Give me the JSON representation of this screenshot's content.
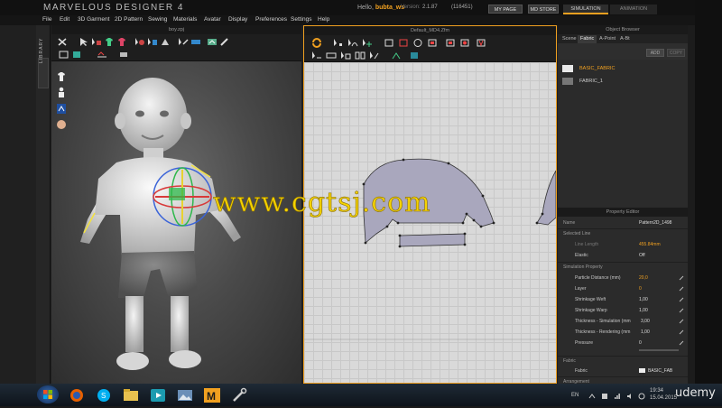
{
  "app": {
    "title": "MARVELOUS DESIGNER 4",
    "greeting_prefix": "Hello,",
    "username": "bubta_ws",
    "version_label": "Version:",
    "version": "2.1.87",
    "build": "(116451)",
    "my_page": "MY PAGE",
    "md_store": "MD STORE",
    "mode_simulation": "SIMULATION",
    "mode_animation": "ANIMATION"
  },
  "menu": [
    "File",
    "Edit",
    "3D Garment",
    "2D Pattern",
    "Sewing",
    "Materials",
    "Avatar",
    "Display",
    "Preferences",
    "Settings",
    "Help"
  ],
  "library_label": "LIBRARY",
  "window3d_title": "boy.zpj",
  "window2d_title": "Default_MD4.Zfm",
  "object_browser": {
    "title": "Object Browser",
    "tabs": [
      "Scene",
      "Fabric",
      "A-Point",
      "A-Bt"
    ],
    "active_tab": "Fabric",
    "add_label": "ADD",
    "copy_label": "COPY",
    "fabrics": [
      {
        "name": "BASIC_FABRIC",
        "swatch": "#e8e8e8",
        "selected": true
      },
      {
        "name": "FABRIC_1",
        "swatch": "#777777",
        "selected": false
      }
    ]
  },
  "property_editor": {
    "title": "Property Editor",
    "rows": [
      {
        "label": "Name",
        "value": "Pattern2D_1498",
        "type": "field"
      },
      {
        "label": "Selected Line",
        "value": "",
        "type": "section"
      },
      {
        "label": "Line Length",
        "value": "455.84mm",
        "type": "field",
        "orange": true
      },
      {
        "label": "Elastic",
        "value": "Off",
        "type": "field"
      },
      {
        "label": "Simulation Property",
        "value": "",
        "type": "section"
      },
      {
        "label": "Particle Distance (mm)",
        "value": "20,0",
        "type": "field",
        "orange": true
      },
      {
        "label": "Layer",
        "value": "0",
        "type": "field",
        "orange": true
      },
      {
        "label": "Shrinkage Weft",
        "value": "1,00",
        "type": "field"
      },
      {
        "label": "Shrinkage Warp",
        "value": "1,00",
        "type": "field"
      },
      {
        "label": "Thickness - Simulation (mm",
        "value": "3,00",
        "type": "field"
      },
      {
        "label": "Thickness - Rendering (mm",
        "value": "1,00",
        "type": "field"
      },
      {
        "label": "Pressure",
        "value": "0",
        "type": "field"
      },
      {
        "label": "Fabric",
        "value": "",
        "type": "section"
      },
      {
        "label": "Fabric",
        "value": "BASIC_FAB",
        "type": "field"
      },
      {
        "label": "Arrangement",
        "value": "",
        "type": "section"
      }
    ]
  },
  "watermark": "www.cgtsj.com",
  "taskbar": {
    "language": "EN",
    "time": "19:34",
    "date": "15.04.2015",
    "brand": "udemy"
  },
  "colors": {
    "accent": "#f0a020",
    "watermark": "#f5d300",
    "pattern_fill": "#a9a7bd"
  }
}
